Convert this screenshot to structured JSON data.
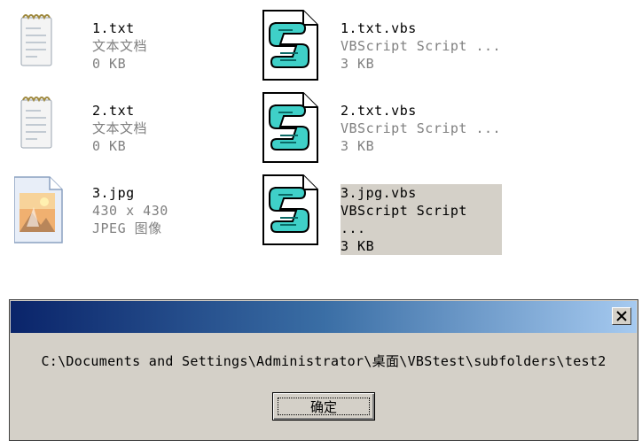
{
  "files": [
    {
      "name": "1.txt",
      "line2": "文本文档",
      "line3": "0 KB",
      "icon": "text-document-icon"
    },
    {
      "name": "1.txt.vbs",
      "line2": "VBScript Script ...",
      "line3": "3 KB",
      "icon": "vbscript-file-icon"
    },
    {
      "name": "2.txt",
      "line2": "文本文档",
      "line3": "0 KB",
      "icon": "text-document-icon"
    },
    {
      "name": "2.txt.vbs",
      "line2": "VBScript Script ...",
      "line3": "3 KB",
      "icon": "vbscript-file-icon"
    },
    {
      "name": "3.jpg",
      "line2": "430 x 430",
      "line3": "JPEG 图像",
      "icon": "image-file-icon"
    },
    {
      "name": "3.jpg.vbs",
      "line2": "VBScript Script ...",
      "line3": "3 KB",
      "icon": "vbscript-file-icon",
      "selected": true
    }
  ],
  "dialog": {
    "title": "",
    "close_label": "×",
    "message": "C:\\Documents and Settings\\Administrator\\桌面\\VBStest\\subfolders\\test2",
    "ok_label": "确定"
  },
  "colors": {
    "titlebar_start": "#0a246a",
    "titlebar_end": "#a6caf0",
    "dialog_face": "#d4d0c8",
    "selection": "#d4d0c8",
    "secondary_text": "#808080"
  }
}
